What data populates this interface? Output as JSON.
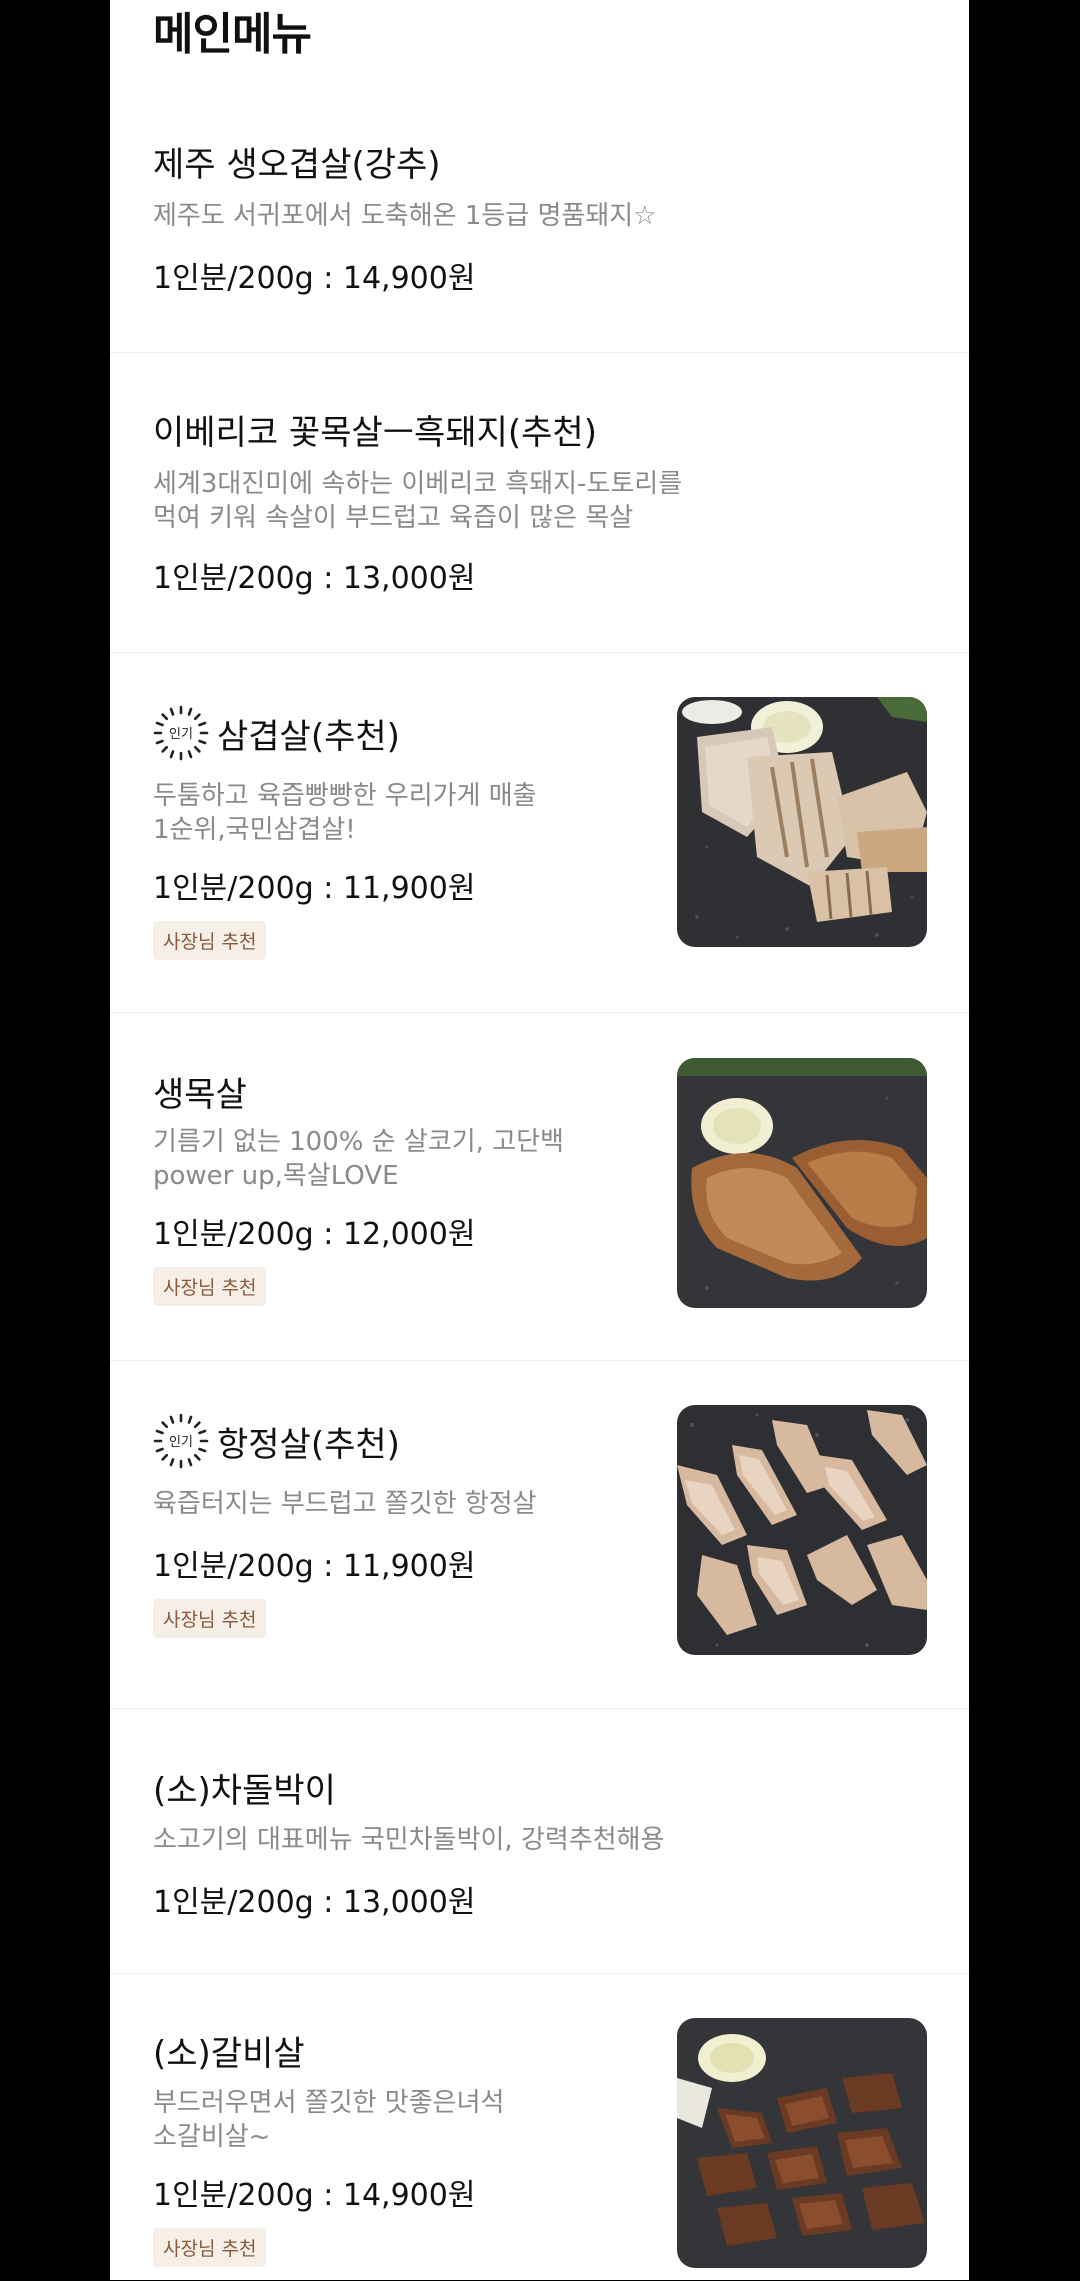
{
  "section": {
    "title": "메인메뉴"
  },
  "popular_label": "인기",
  "items": [
    {
      "name": "제주 생오겹살(강추)",
      "desc": [
        "제주도 서귀포에서 도축해온 1등급 명품돼지☆"
      ],
      "price": "1인분/200g : 14,900원"
    },
    {
      "name": "이베리코 꽃목살ㅡ흑돼지(추천)",
      "desc": [
        "세계3대진미에 속하는  이베리코 흑돼지-도토리를",
        "먹여 키워  속살이 부드럽고 육즙이 많은 목살"
      ],
      "price": "1인분/200g : 13,000원"
    },
    {
      "name": "삼겹살(추천)",
      "popular": true,
      "desc": [
        "두툼하고 육즙빵빵한 우리가게  매출",
        "1순위,국민삼겹살!"
      ],
      "price": "1인분/200g : 11,900원",
      "badge": "사장님 추천",
      "image": "grilled-pork-belly"
    },
    {
      "name": "생목살",
      "desc": [
        "기름기 없는  100% 순 살코기, 고단백",
        "power up,목살LOVE"
      ],
      "price": "1인분/200g : 12,000원",
      "badge": "사장님 추천",
      "image": "grilled-pork-neck"
    },
    {
      "name": "항정살(추천)",
      "popular": true,
      "desc": [
        "육즙터지는 부드럽고 쫄깃한 항정살"
      ],
      "price": "1인분/200g : 11,900원",
      "badge": "사장님 추천",
      "image": "grilled-pork-jowl"
    },
    {
      "name": "(소)차돌박이",
      "desc": [
        "소고기의 대표메뉴  국민차돌박이, 강력추천해용"
      ],
      "price": "1인분/200g : 13,000원"
    },
    {
      "name": "(소)갈비살",
      "desc": [
        "부드러우면서 쫄깃한 맛좋은녀석",
        "소갈비살~"
      ],
      "price": "1인분/200g : 14,900원",
      "badge": "사장님 추천",
      "image": "grilled-beef-rib"
    }
  ]
}
